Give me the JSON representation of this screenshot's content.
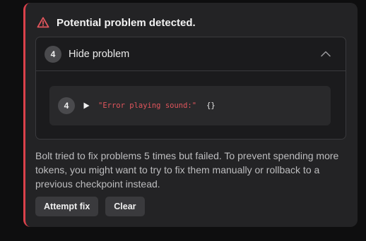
{
  "alert": {
    "title": "Potential problem detected.",
    "icon": "warning-triangle-icon",
    "accent_color": "#d9414b"
  },
  "problems": {
    "count": "4",
    "toggle_label": "Hide problem",
    "items": [
      {
        "index": "4",
        "message": "\"Error playing sound:\"",
        "detail": "{}"
      }
    ]
  },
  "message": "Bolt tried to fix problems 5 times but failed. To prevent spending more tokens, you might want to try to fix them manually or rollback to a previous checkpoint instead.",
  "actions": {
    "attempt_fix_label": "Attempt fix",
    "clear_label": "Clear"
  }
}
